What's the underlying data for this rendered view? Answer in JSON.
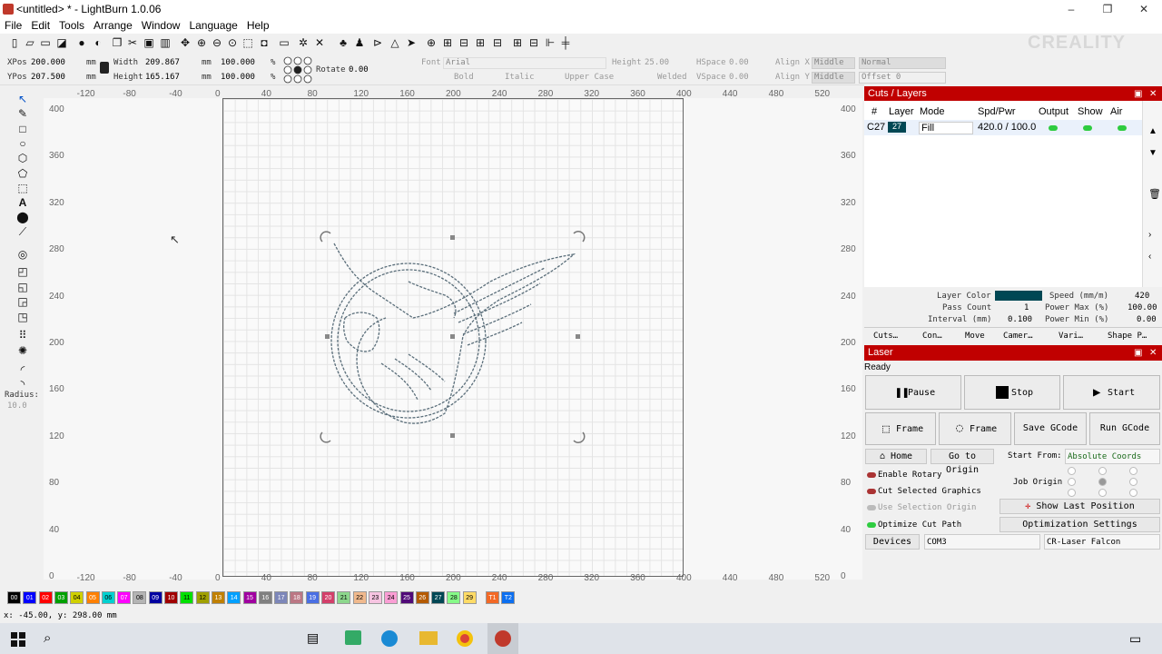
{
  "window": {
    "title": "<untitled> * - LightBurn 1.0.06",
    "min": "–",
    "max": "❐",
    "close": "✕"
  },
  "menu": [
    "File",
    "Edit",
    "Tools",
    "Arrange",
    "Window",
    "Language",
    "Help"
  ],
  "watermark": "CREALITY",
  "props": {
    "xpos_label": "XPos",
    "xpos": "200.000",
    "ypos_label": "YPos",
    "ypos": "207.500",
    "unit": "mm",
    "width_label": "Width",
    "width": "209.867",
    "height_label": "Height",
    "height": "165.167",
    "scale_w": "100.000",
    "scale_h": "100.000",
    "pct": "%",
    "rotate_label": "Rotate",
    "rotate": "0.00",
    "font_label": "Font",
    "font": "Arial",
    "font_height_label": "Height",
    "font_height": "25.00",
    "hspace_label": "HSpace",
    "hspace": "0.00",
    "vspace_label": "VSpace",
    "vspace": "0.00",
    "alignx_label": "Align X",
    "alignx": "Middle",
    "aligny_label": "Align Y",
    "aligny": "Middle",
    "normal": "Normal",
    "offset": "Offset 0",
    "bold": "Bold",
    "italic": "Italic",
    "upper": "Upper Case",
    "welded": "Welded"
  },
  "left_radius_label": "Radius:",
  "left_radius": "10.0",
  "ruler_x": [
    "-120",
    "-80",
    "-40",
    "0",
    "40",
    "80",
    "120",
    "160",
    "200",
    "240",
    "280",
    "320",
    "360",
    "400",
    "440",
    "480",
    "520"
  ],
  "ruler_y": [
    "400",
    "360",
    "320",
    "280",
    "240",
    "200",
    "160",
    "120",
    "80",
    "40",
    "0"
  ],
  "palette": [
    {
      "l": "00",
      "c": "#000000"
    },
    {
      "l": "01",
      "c": "#0000ff"
    },
    {
      "l": "02",
      "c": "#ff0000"
    },
    {
      "l": "03",
      "c": "#00a000"
    },
    {
      "l": "04",
      "c": "#d0d000"
    },
    {
      "l": "05",
      "c": "#ff8000"
    },
    {
      "l": "06",
      "c": "#00d0d0"
    },
    {
      "l": "07",
      "c": "#ff00ff"
    },
    {
      "l": "08",
      "c": "#b4b4b4"
    },
    {
      "l": "09",
      "c": "#0000a0"
    },
    {
      "l": "10",
      "c": "#a00000"
    },
    {
      "l": "11",
      "c": "#00e000"
    },
    {
      "l": "12",
      "c": "#a0a000"
    },
    {
      "l": "13",
      "c": "#c08000"
    },
    {
      "l": "14",
      "c": "#00a0ff"
    },
    {
      "l": "15",
      "c": "#a000a0"
    },
    {
      "l": "16",
      "c": "#808080"
    },
    {
      "l": "17",
      "c": "#7d87b9"
    },
    {
      "l": "18",
      "c": "#bb7784"
    },
    {
      "l": "19",
      "c": "#4a6fe3"
    },
    {
      "l": "20",
      "c": "#d33f6a"
    },
    {
      "l": "21",
      "c": "#8cd78c"
    },
    {
      "l": "22",
      "c": "#f0b98d"
    },
    {
      "l": "23",
      "c": "#f6c4e1"
    },
    {
      "l": "24",
      "c": "#fa9ed4"
    },
    {
      "l": "25",
      "c": "#500a78"
    },
    {
      "l": "26",
      "c": "#b45a00"
    },
    {
      "l": "27",
      "c": "#004754"
    },
    {
      "l": "28",
      "c": "#86fa88"
    },
    {
      "l": "29",
      "c": "#ffdb66"
    },
    {
      "l": "T1",
      "c": "#f36926"
    },
    {
      "l": "T2",
      "c": "#0c6ff0"
    }
  ],
  "status_text": "x: -45.00, y: 298.00 mm",
  "cuts": {
    "title": "Cuts / Layers",
    "headers": [
      "#",
      "Layer",
      "Mode",
      "Spd/Pwr",
      "Output",
      "Show",
      "Air"
    ],
    "row": {
      "id": "C27",
      "layer": "27",
      "mode": "Fill",
      "spd": "420.0 / 100.0"
    },
    "layer_color_label": "Layer Color",
    "layer_color": "#004754",
    "speed_label": "Speed (mm/m)",
    "speed": "420",
    "pass_label": "Pass Count",
    "pass": "1",
    "pmax_label": "Power Max (%)",
    "pmax": "100.00",
    "interval_label": "Interval (mm)",
    "interval": "0.100",
    "pmin_label": "Power Min (%)",
    "pmin": "0.00",
    "tabs": [
      "Cuts…",
      "Con…",
      "Move",
      "Camer…",
      "Vari…",
      "Shape P…"
    ]
  },
  "laser": {
    "title": "Laser",
    "status": "Ready",
    "pause": "Pause",
    "stop": "Stop",
    "start": "Start",
    "frame1": "Frame",
    "frame2": "Frame",
    "save_gcode": "Save GCode",
    "run_gcode": "Run GCode",
    "home": "Home",
    "goto_origin": "Go to Origin",
    "start_from_label": "Start From:",
    "start_from": "Absolute Coords",
    "enable_rotary": "Enable Rotary",
    "cut_selected": "Cut Selected Graphics",
    "use_selection": "Use Selection Origin",
    "job_origin": "Job Origin",
    "show_last": "Show Last Position",
    "optimize": "Optimize Cut Path",
    "opt_settings": "Optimization Settings",
    "devices": "Devices",
    "port": "COM3",
    "device": "CR-Laser Falcon"
  }
}
